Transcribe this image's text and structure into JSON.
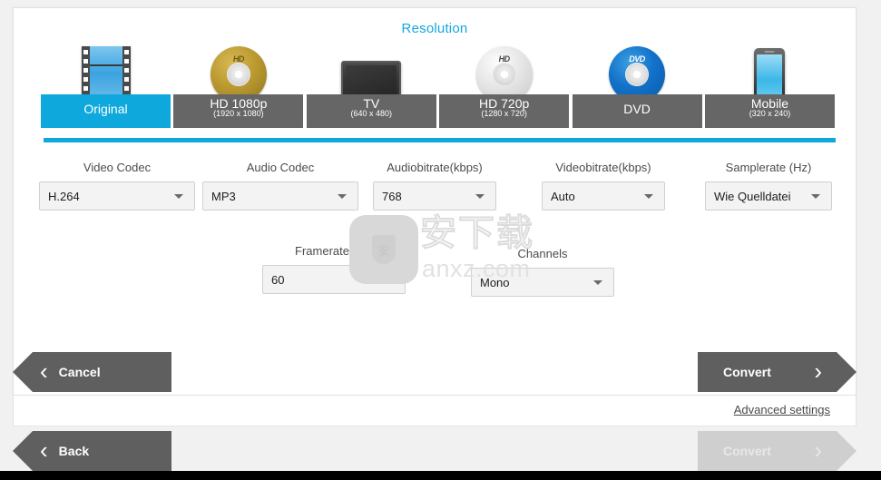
{
  "header": {
    "section_title": "Resolution",
    "accent_color": "#0fa8dd"
  },
  "resolution_presets": [
    {
      "name": "Original",
      "dimensions": "",
      "icon": "film-strip-icon",
      "selected": true
    },
    {
      "name": "HD 1080p",
      "dimensions": "(1920 x 1080)",
      "icon": "gold-disc-icon",
      "selected": false
    },
    {
      "name": "TV",
      "dimensions": "(640 x 480)",
      "icon": "television-icon",
      "selected": false
    },
    {
      "name": "HD 720p",
      "dimensions": "(1280 x 720)",
      "icon": "silver-disc-icon",
      "selected": false
    },
    {
      "name": "DVD",
      "dimensions": "",
      "icon": "blue-disc-icon",
      "selected": false
    },
    {
      "name": "Mobile",
      "dimensions": "(320 x 240)",
      "icon": "mobile-phone-icon",
      "selected": false
    }
  ],
  "disc_tags": {
    "hd_1080": "HD",
    "hd_720": "HD",
    "dvd": "DVD"
  },
  "settings": {
    "video_codec": {
      "label": "Video Codec",
      "value": "H.264"
    },
    "audio_codec": {
      "label": "Audio Codec",
      "value": "MP3"
    },
    "audio_bitrate": {
      "label": "Audiobitrate(kbps)",
      "value": "768"
    },
    "video_bitrate": {
      "label": "Videobitrate(kbps)",
      "value": "Auto"
    },
    "samplerate": {
      "label": "Samplerate (Hz)",
      "value": "Wie Quelldatei"
    },
    "framerate": {
      "label": "Framerate(fps)",
      "value": "60"
    },
    "channels": {
      "label": "Channels",
      "value": "Mono"
    }
  },
  "watermark": {
    "chinese_text": "安下载",
    "url_text": "anxz.com"
  },
  "actions": {
    "cancel_label": "Cancel",
    "convert_label": "Convert",
    "back_label": "Back",
    "convert_disabled_label": "Convert",
    "advanced_settings_label": "Advanced settings",
    "chevron_left": "‹",
    "chevron_right": "›"
  }
}
